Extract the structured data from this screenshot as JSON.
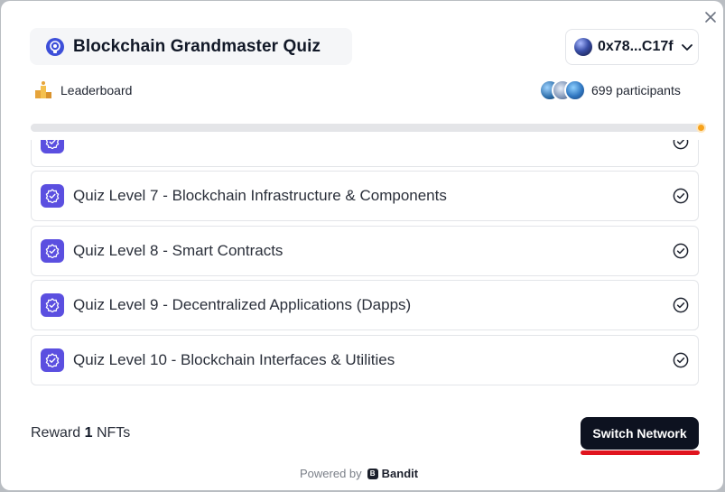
{
  "header": {
    "title": "Blockchain Grandmaster Quiz",
    "wallet_address": "0x78...C17f"
  },
  "leaderboard": {
    "label": "Leaderboard"
  },
  "participants": {
    "count_label": "699 participants"
  },
  "progress": {
    "value": 1.0
  },
  "levels": [
    {
      "label": "",
      "completed": true
    },
    {
      "label": "Quiz Level 7 - Blockchain Infrastructure & Components",
      "completed": true
    },
    {
      "label": "Quiz Level 8 - Smart Contracts",
      "completed": true
    },
    {
      "label": "Quiz Level 9 - Decentralized Applications (Dapps)",
      "completed": true
    },
    {
      "label": "Quiz Level 10 - Blockchain Interfaces & Utilities",
      "completed": true
    }
  ],
  "footer": {
    "reward_prefix": "Reward",
    "reward_count": "1",
    "reward_suffix": "NFTs",
    "switch_label": "Switch Network",
    "powered_by": "Powered by",
    "brand_letter": "B",
    "brand": "Bandit"
  },
  "colors": {
    "accent": "#5b4fe0",
    "button_dark": "#0d1220",
    "progress_knob": "#f7a21b",
    "underline_red": "#e0141e"
  },
  "icons": {
    "close": "close-icon",
    "logo": "quiz-logo-icon",
    "wallet": "wallet-orb-icon",
    "chevron": "chevron-down-icon",
    "leaderboard": "podium-icon",
    "level_badge": "verified-badge-icon",
    "check": "check-circle-icon",
    "brand": "bandit-logo-icon"
  }
}
